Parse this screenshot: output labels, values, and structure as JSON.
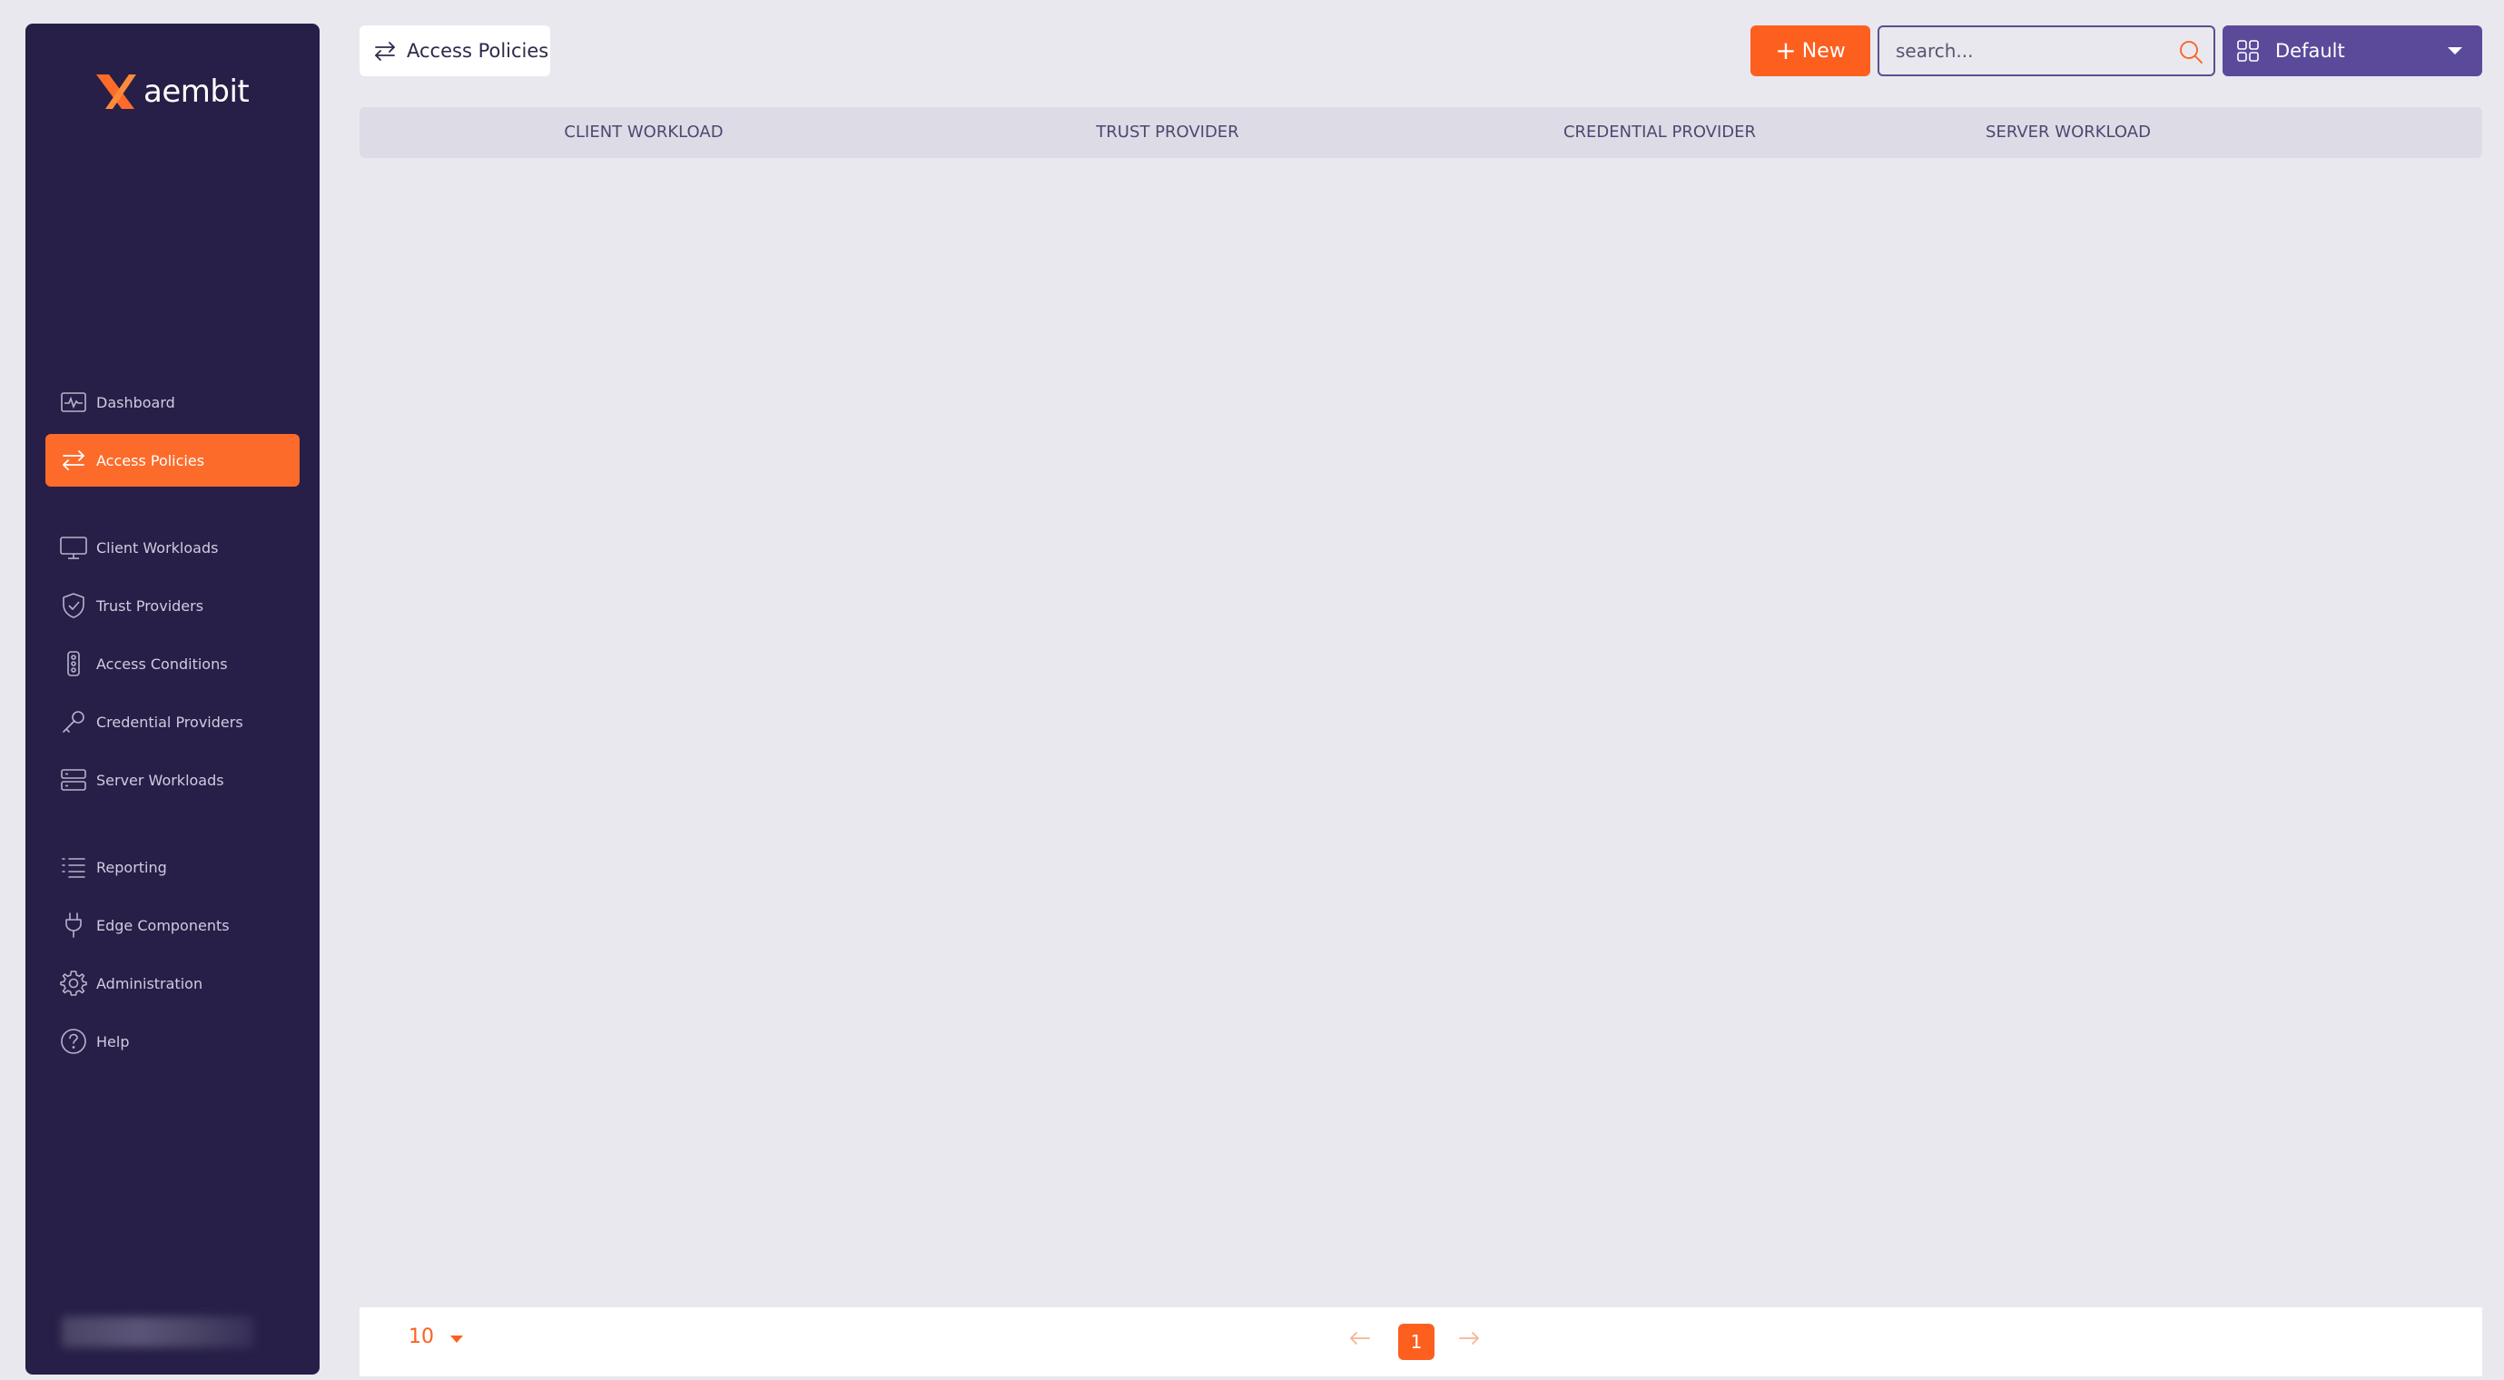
{
  "brand": {
    "name": "aembit",
    "accent_color": "#fd6b2a",
    "sidebar_color": "#271f47"
  },
  "sidebar": {
    "items": [
      {
        "label": "Dashboard",
        "icon": "pulse-monitor-icon",
        "active": false
      },
      {
        "label": "Access Policies",
        "icon": "arrows-exchange-icon",
        "active": true
      },
      {
        "label": "Client Workloads",
        "icon": "monitor-icon",
        "active": false
      },
      {
        "label": "Trust Providers",
        "icon": "shield-check-icon",
        "active": false
      },
      {
        "label": "Access Conditions",
        "icon": "traffic-light-icon",
        "active": false
      },
      {
        "label": "Credential Providers",
        "icon": "key-icon",
        "active": false
      },
      {
        "label": "Server Workloads",
        "icon": "server-icon",
        "active": false
      },
      {
        "label": "Reporting",
        "icon": "list-icon",
        "active": false
      },
      {
        "label": "Edge Components",
        "icon": "plug-icon",
        "active": false
      },
      {
        "label": "Administration",
        "icon": "gear-icon",
        "active": false
      },
      {
        "label": "Help",
        "icon": "question-circle-icon",
        "active": false
      }
    ]
  },
  "header": {
    "breadcrumb_label": "Access Policies",
    "new_button_label": "New",
    "search_placeholder": "search...",
    "view_selector_value": "Default"
  },
  "table": {
    "columns": [
      "CLIENT WORKLOAD",
      "TRUST PROVIDER",
      "CREDENTIAL PROVIDER",
      "SERVER WORKLOAD"
    ],
    "rows": []
  },
  "pagination": {
    "page_size": "10",
    "current_page": "1"
  }
}
